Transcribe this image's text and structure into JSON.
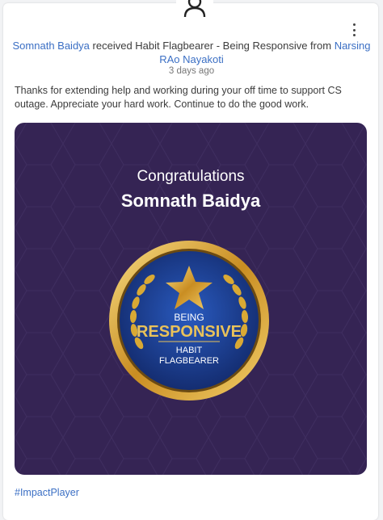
{
  "post": {
    "sender_prefix": "",
    "recipient_name": "Somnath Baidya",
    "received_text": " received Habit Flagbearer - Being Responsive from ",
    "giver_name": "Narsing RAo Nayakoti",
    "time_ago": "3 days ago",
    "message": "Thanks for extending help and working during your off time to support CS outage. Appreciate your hard work. Continue to do the good work.",
    "hashtag": "#ImpactPlayer"
  },
  "banner": {
    "heading": "Congratulations",
    "name": "Somnath Baidya",
    "badge_line1": "BEING",
    "badge_line2": "RESPONSIVE",
    "badge_line3": "HABIT",
    "badge_line4": "FLAGBEARER"
  },
  "colors": {
    "link": "#3b6fc4",
    "banner_bg": "#352454",
    "badge_gold": "#d9a934",
    "badge_blue": "#1c3f8f"
  }
}
